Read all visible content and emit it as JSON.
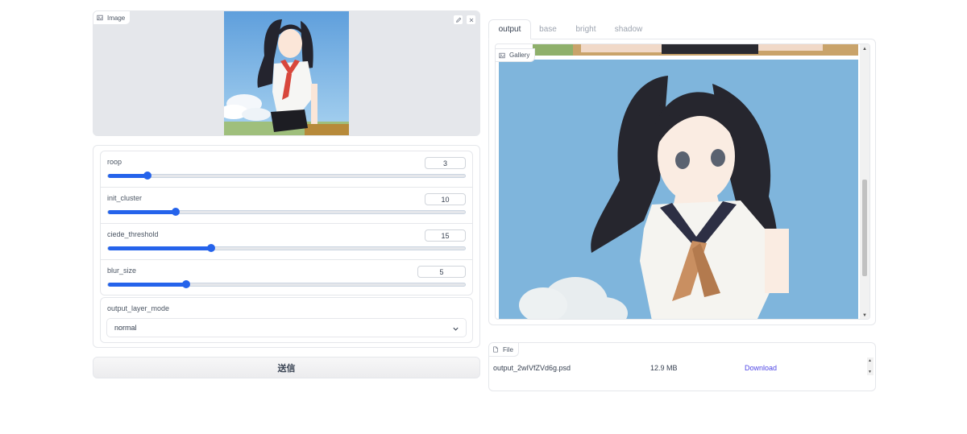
{
  "image_block": {
    "label": "Image",
    "edit_icon": "pencil-icon",
    "clear_icon": "close-icon"
  },
  "sliders": [
    {
      "label": "roop",
      "value": "3",
      "fraction": 0.11
    },
    {
      "label": "init_cluster",
      "value": "10",
      "fraction": 0.19
    },
    {
      "label": "ciede_threshold",
      "value": "15",
      "fraction": 0.29
    },
    {
      "label": "blur_size",
      "value": "5",
      "fraction": 0.22
    }
  ],
  "dropdown": {
    "label": "output_layer_mode",
    "selected": "normal"
  },
  "submit_label": "送信",
  "tabs": [
    "output",
    "base",
    "bright",
    "shadow"
  ],
  "active_tab": "output",
  "gallery": {
    "label": "Gallery"
  },
  "file_block": {
    "label": "File",
    "file_name": "output_2wIVfZVd6g.psd",
    "file_size": "12.9 MB",
    "download_label": "Download"
  },
  "colors": {
    "accent": "#2563eb",
    "link": "#4f46e5",
    "panel_bg": "#e5e7eb",
    "sky": "#7fb5dc"
  }
}
